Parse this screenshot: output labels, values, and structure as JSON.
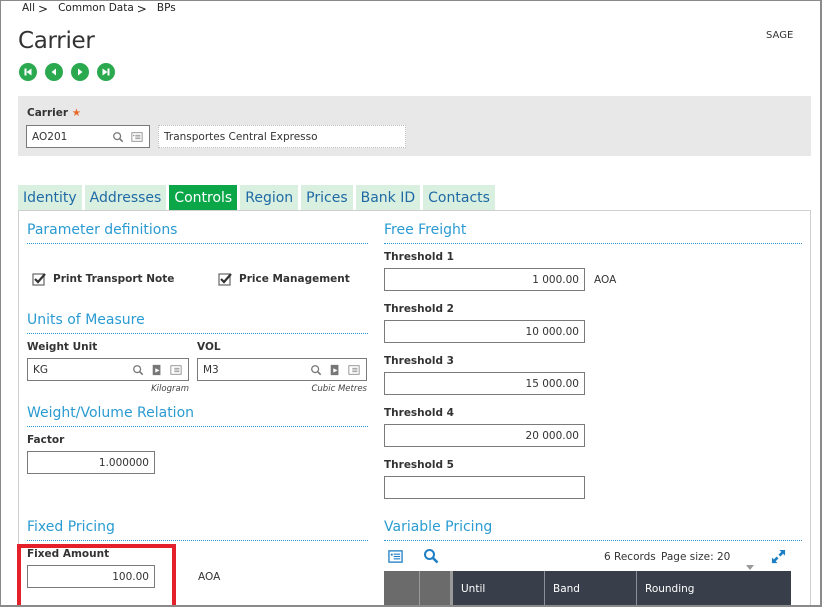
{
  "breadcrumb": [
    {
      "label": "All"
    },
    {
      "label": "Common Data"
    },
    {
      "label": "BPs"
    }
  ],
  "breadcrumb_separator": ">",
  "page": {
    "title": "Carrier",
    "user": "SAGE"
  },
  "nav_buttons": [
    {
      "name": "first-record",
      "icon": "first-icon"
    },
    {
      "name": "previous-record",
      "icon": "previous-icon"
    },
    {
      "name": "next-record",
      "icon": "next-icon"
    },
    {
      "name": "last-record",
      "icon": "last-icon"
    }
  ],
  "header": {
    "carrier_label": "Carrier",
    "required_mark": "★",
    "carrier_code": "AO201",
    "carrier_description": "Transportes Central Expresso"
  },
  "tabs": [
    {
      "label": "Identity",
      "active": false
    },
    {
      "label": "Addresses",
      "active": false
    },
    {
      "label": "Controls",
      "active": true
    },
    {
      "label": "Region",
      "active": false
    },
    {
      "label": "Prices",
      "active": false
    },
    {
      "label": "Bank ID",
      "active": false
    },
    {
      "label": "Contacts",
      "active": false
    }
  ],
  "parameters": {
    "title": "Parameter definitions",
    "print_transport_note": {
      "label": "Print Transport Note",
      "checked": true
    },
    "price_management": {
      "label": "Price Management",
      "checked": true
    }
  },
  "units": {
    "title": "Units of Measure",
    "weight_unit": {
      "label": "Weight Unit",
      "value": "KG",
      "description": "Kilogram"
    },
    "vol": {
      "label": "VOL",
      "value": "M3",
      "description": "Cubic Metres"
    }
  },
  "weight_volume": {
    "title": "Weight/Volume Relation",
    "factor_label": "Factor",
    "factor_value": "1.000000"
  },
  "fixed_pricing": {
    "title": "Fixed Pricing",
    "amount_label": "Fixed Amount",
    "amount_value": "100.00",
    "currency": "AOA"
  },
  "free_freight": {
    "title": "Free Freight",
    "currency": "AOA",
    "thresholds": [
      {
        "label": "Threshold 1",
        "value": "1 000.00"
      },
      {
        "label": "Threshold 2",
        "value": "10 000.00"
      },
      {
        "label": "Threshold 3",
        "value": "15 000.00"
      },
      {
        "label": "Threshold 4",
        "value": "20 000.00"
      },
      {
        "label": "Threshold 5",
        "value": ""
      }
    ]
  },
  "variable_pricing": {
    "title": "Variable Pricing",
    "records": "6 Records",
    "page_size_label": "Page size:",
    "page_size": "20",
    "columns": [
      "Until",
      "Band",
      "Rounding"
    ]
  },
  "colors": {
    "accent_green": "#0aa648",
    "nav_green": "#2aa94f",
    "section_blue": "#2a9bd2",
    "tab_inactive_bg": "#d9f0e0",
    "tab_text": "#1f6aa5",
    "highlight_red": "#e4202a",
    "grid_header": "#383e4a"
  }
}
